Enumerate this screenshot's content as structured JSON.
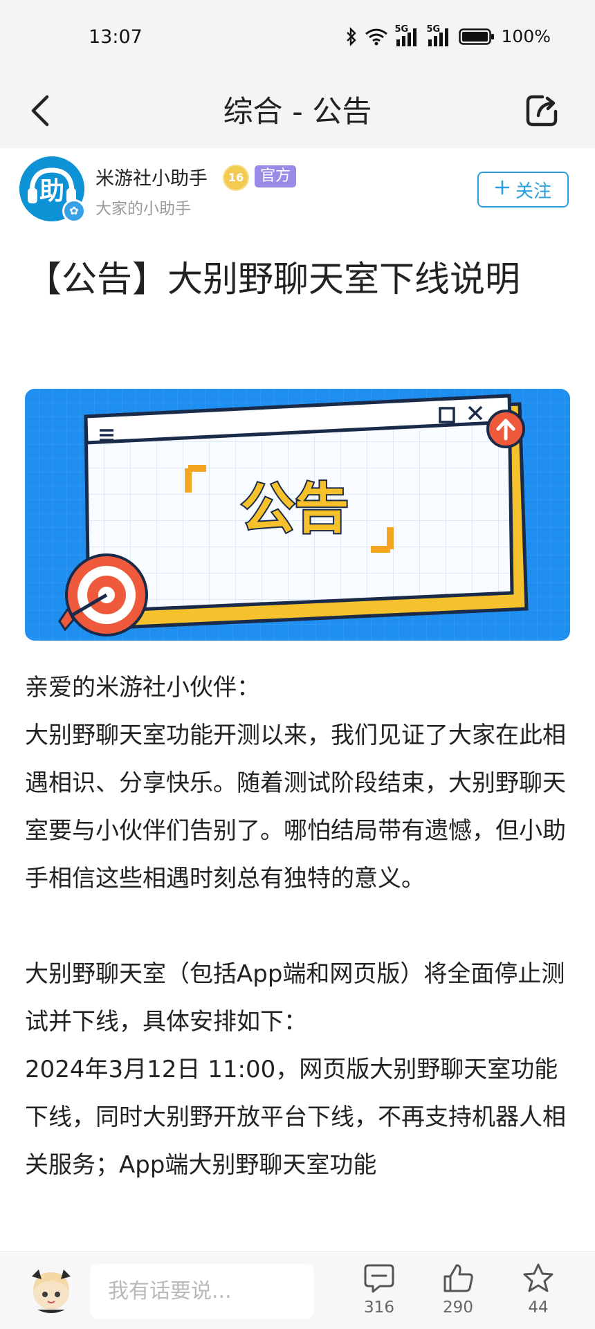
{
  "status_bar": {
    "time": "13:07",
    "signal1_label": "5G",
    "signal2_label": "5G",
    "battery": "100%"
  },
  "nav": {
    "title": "综合 - 公告",
    "back_icon": "chevron-left-icon",
    "share_icon": "share-icon"
  },
  "author": {
    "name": "米游社小助手",
    "avatar_text": "助",
    "level": "16",
    "official_label": "官方",
    "description": "大家的小助手",
    "follow_label": "关注"
  },
  "post": {
    "title": "【公告】大别野聊天室下线说明",
    "banner_text": "公告",
    "paragraphs": [
      "亲爱的米游社小伙伴：",
      "大别野聊天室功能开测以来，我们见证了大家在此相遇相识、分享快乐。随着测试阶段结束，大别野聊天室要与小伙伴们告别了。哪怕结局带有遗憾，但小助手相信这些相遇时刻总有独特的意义。",
      "大别野聊天室（包括App端和网页版）将全面停止测试并下线，具体安排如下：",
      "2024年3月12日 11:00，网页版大别野聊天室功能下线，同时大别野开放平台下线，不再支持机器人相关服务；App端大别野聊天室功能"
    ]
  },
  "bottom_bar": {
    "comment_placeholder": "我有话要说...",
    "comments": "316",
    "likes": "290",
    "favorites": "44"
  },
  "colors": {
    "accent": "#2ba0e0",
    "official": "#9b8be8",
    "banner_blue": "#1f8ff0",
    "banner_yellow": "#f5c12c"
  }
}
